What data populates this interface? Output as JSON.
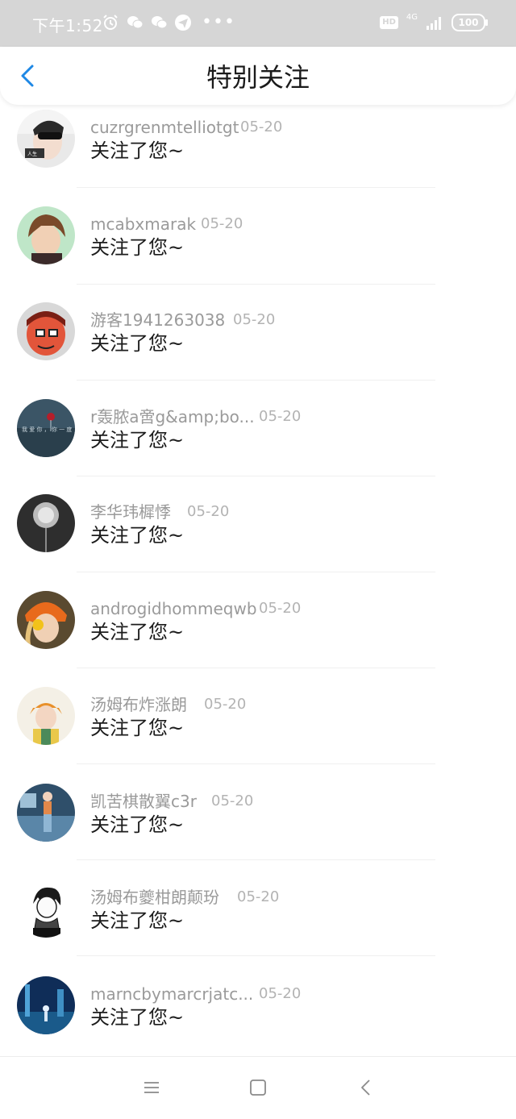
{
  "status_bar": {
    "time": "下午1:52",
    "hd": "HD",
    "network": "4G",
    "battery": "100",
    "icons": [
      "alarm-icon",
      "wechat-icon",
      "wechat-icon",
      "paper-plane-icon",
      "more-dots-icon",
      "signal-icon"
    ]
  },
  "header": {
    "title": "特别关注",
    "back_icon": "chevron-left-icon",
    "accent": "#1e88e5"
  },
  "items": [
    {
      "name": "cuzrgrenmtelliotgt",
      "date": "05-20",
      "message": "关注了您~"
    },
    {
      "name": "mcabxmarak",
      "date": "05-20",
      "message": "关注了您~"
    },
    {
      "name": "游客1941263038",
      "date": "05-20",
      "message": "关注了您~"
    },
    {
      "name": "r轰脓a啻g&amp;bo...",
      "date": "05-20",
      "message": "关注了您~"
    },
    {
      "name": "李华玮樨悸",
      "date": "05-20",
      "message": "关注了您~"
    },
    {
      "name": "androgidhommeqwb",
      "date": "05-20",
      "message": "关注了您~"
    },
    {
      "name": "汤姆布炸涨朗",
      "date": "05-20",
      "message": "关注了您~"
    },
    {
      "name": "凯苦棋散翼c3r",
      "date": "05-20",
      "message": "关注了您~"
    },
    {
      "name": "汤姆布夔柑朗颠玢",
      "date": "05-20",
      "message": "关注了您~"
    },
    {
      "name": "marncbymarcrjatc...",
      "date": "05-20",
      "message": "关注了您~"
    }
  ],
  "nav_bar": {
    "icons": [
      "menu-icon",
      "home-square-icon",
      "back-triangle-icon"
    ]
  }
}
